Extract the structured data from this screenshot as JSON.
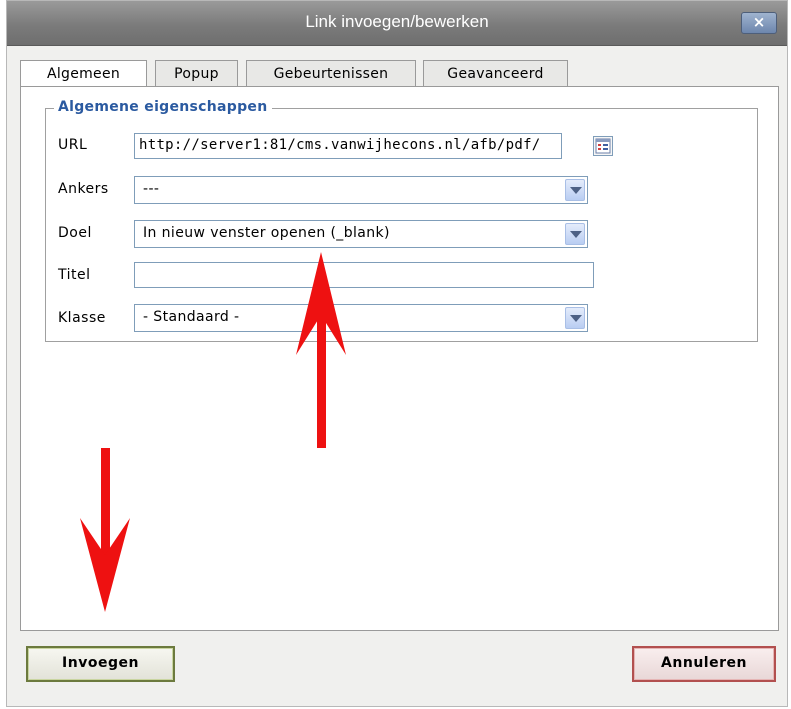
{
  "dialog": {
    "title": "Link invoegen/bewerken",
    "close_label": "×"
  },
  "tabs": [
    "Algemeen",
    "Popup",
    "Gebeurtenissen",
    "Geavanceerd"
  ],
  "active_tab": "Algemeen",
  "fieldset": {
    "legend": "Algemene eigenschappen"
  },
  "fields": {
    "url": {
      "label": "URL",
      "value": "http://server1:81/cms.vanwijhecons.nl/afb/pdf/"
    },
    "ankers": {
      "label": "Ankers",
      "value": "---"
    },
    "doel": {
      "label": "Doel",
      "value": "In nieuw venster openen (_blank)"
    },
    "titel": {
      "label": "Titel",
      "value": ""
    },
    "klasse": {
      "label": "Klasse",
      "value": "- Standaard -"
    }
  },
  "buttons": {
    "insert": "Invoegen",
    "cancel": "Annuleren"
  },
  "colors": {
    "annotation_arrow": "#ee1111",
    "legend_text": "#2b5aa0"
  }
}
